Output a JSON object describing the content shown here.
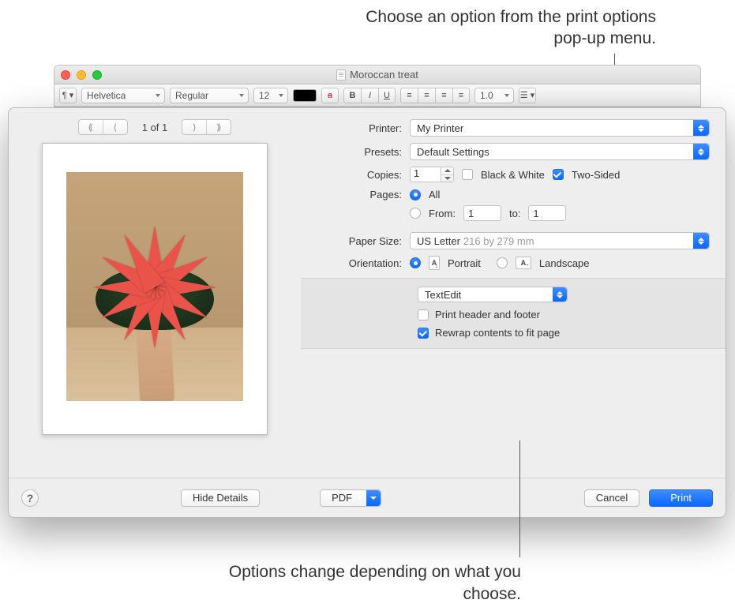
{
  "callouts": {
    "top": "Choose an option from the print options pop-up menu.",
    "bottom": "Options change depending on what you choose."
  },
  "window": {
    "title": "Moroccan treat"
  },
  "toolbar": {
    "font_family": "Helvetica",
    "font_style": "Regular",
    "font_size": "12",
    "line_spacing": "1.0"
  },
  "preview": {
    "page_indicator": "1 of 1"
  },
  "labels": {
    "printer": "Printer:",
    "presets": "Presets:",
    "copies": "Copies:",
    "bw": "Black & White",
    "two_sided": "Two-Sided",
    "pages": "Pages:",
    "all": "All",
    "from": "From:",
    "to": "to:",
    "paper_size": "Paper Size:",
    "orientation": "Orientation:",
    "portrait": "Portrait",
    "landscape": "Landscape",
    "print_header": "Print header and footer",
    "rewrap": "Rewrap contents to fit page"
  },
  "values": {
    "printer": "My Printer",
    "presets": "Default Settings",
    "copies": "1",
    "from": "1",
    "to": "1",
    "paper_size": "US Letter",
    "paper_dim": "216 by 279 mm",
    "section": "TextEdit"
  },
  "footer": {
    "hide_details": "Hide Details",
    "pdf": "PDF",
    "cancel": "Cancel",
    "print": "Print",
    "help": "?"
  }
}
